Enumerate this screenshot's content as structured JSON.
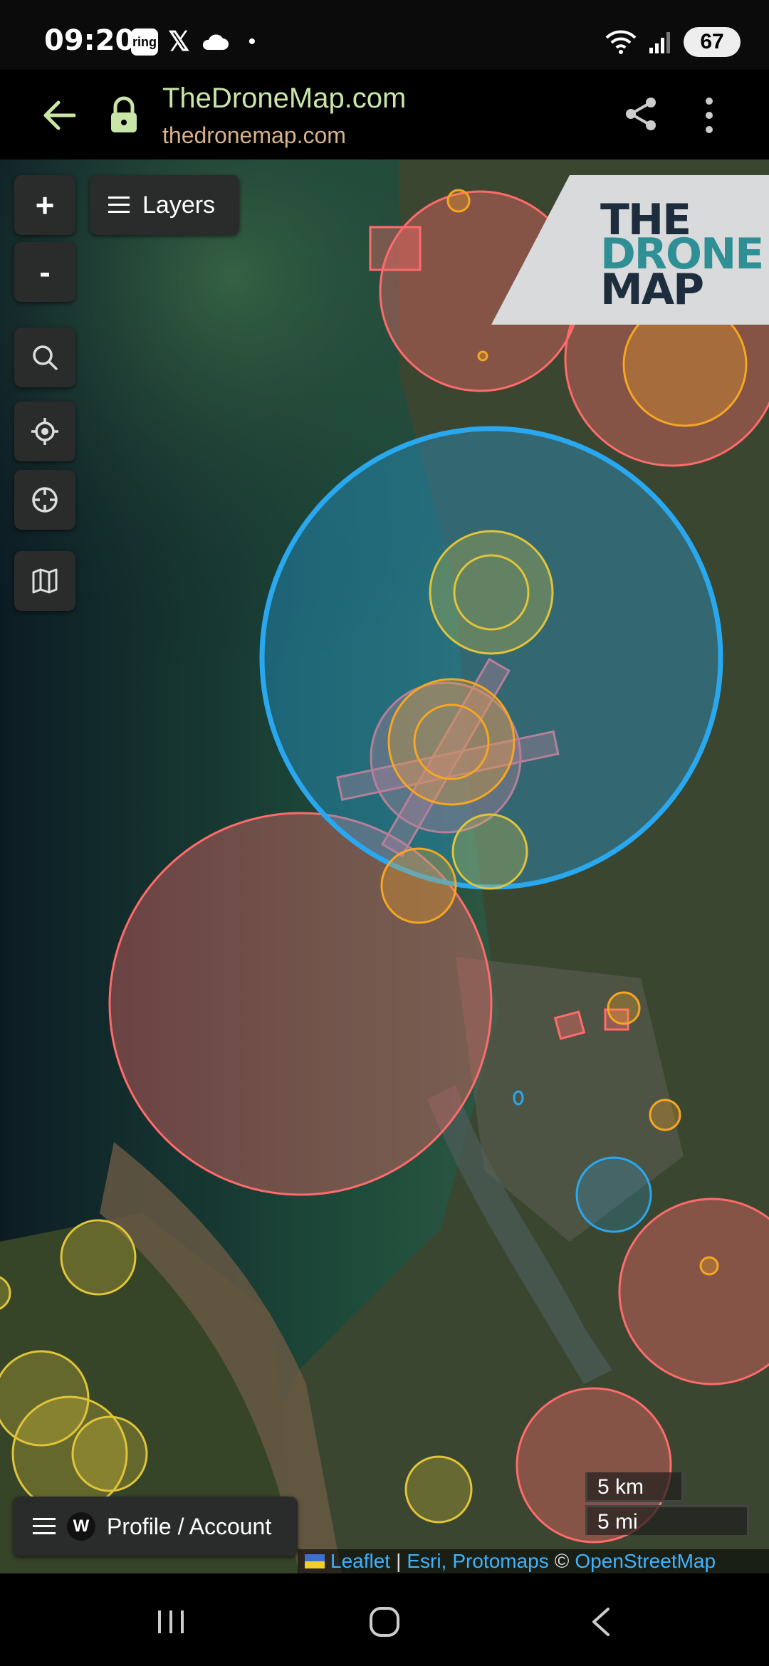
{
  "status_bar": {
    "time": "09:20",
    "ring_label": "ring",
    "x_label": "𝕏",
    "dot": "•",
    "battery": "67"
  },
  "browser": {
    "title": "TheDroneMap.com",
    "url": "thedronemap.com"
  },
  "map_controls": {
    "zoom_in": "+",
    "zoom_out": "-",
    "layers_label": "Layers"
  },
  "logo": {
    "line1": "THE",
    "line2": "DRONE",
    "line3": "MAP"
  },
  "scale": {
    "km": "5 km",
    "mi": "5 mi"
  },
  "profile": {
    "badge": "W",
    "label": "Profile / Account"
  },
  "attribution": {
    "leaflet": "Leaflet",
    "sep1": "|",
    "esri": "Esri,",
    "protomaps": "Protomaps",
    "copy": "©",
    "osm": "OpenStreetMap"
  },
  "colors": {
    "restricted_red": "#ff6b6b",
    "caution_orange": "#f5a623",
    "advisory_yellow": "#e0c43a",
    "airspace_blue": "#29a8f0",
    "link_blue": "#3fb3ff"
  }
}
